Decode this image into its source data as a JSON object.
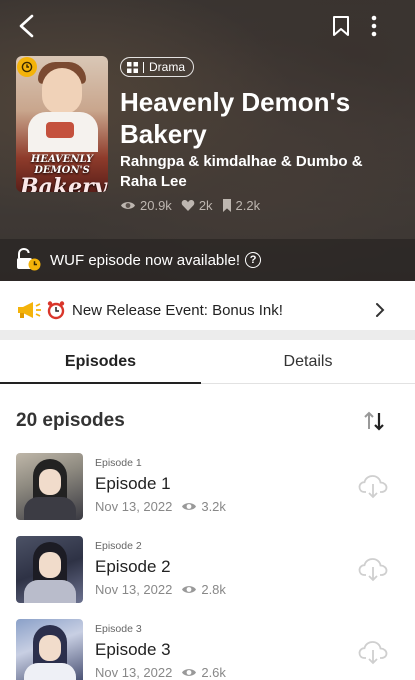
{
  "colors": {
    "accent_gold": "#f4b30a",
    "text_dark": "#222222",
    "text_muted": "#888888",
    "divider": "#ececec"
  },
  "header": {
    "back_icon": "back-arrow-icon",
    "bookmark_icon": "bookmark-icon",
    "more_icon": "more-vertical-icon"
  },
  "series": {
    "cover_title_small": "HEAVENLY DEMON'S",
    "cover_title_big": "Bakery",
    "genre": "Drama",
    "title": "Heavenly Demon's Bakery",
    "authors": "Rahngpa & kimdalhae & Dumbo & Raha Lee",
    "views": "20.9k",
    "likes": "2k",
    "bookmarks": "2.2k"
  },
  "wuf": {
    "text": "WUF episode now available!",
    "help": "?"
  },
  "event": {
    "text": "New Release Event: Bonus Ink!"
  },
  "tabs": [
    {
      "label": "Episodes"
    },
    {
      "label": "Details"
    }
  ],
  "episodes_header": "20 episodes",
  "episodes": [
    {
      "small": "Episode 1",
      "name": "Episode 1",
      "date": "Nov 13, 2022",
      "views": "3.2k"
    },
    {
      "small": "Episode 2",
      "name": "Episode 2",
      "date": "Nov 13, 2022",
      "views": "2.8k"
    },
    {
      "small": "Episode 3",
      "name": "Episode 3",
      "date": "Nov 13, 2022",
      "views": "2.6k"
    }
  ]
}
